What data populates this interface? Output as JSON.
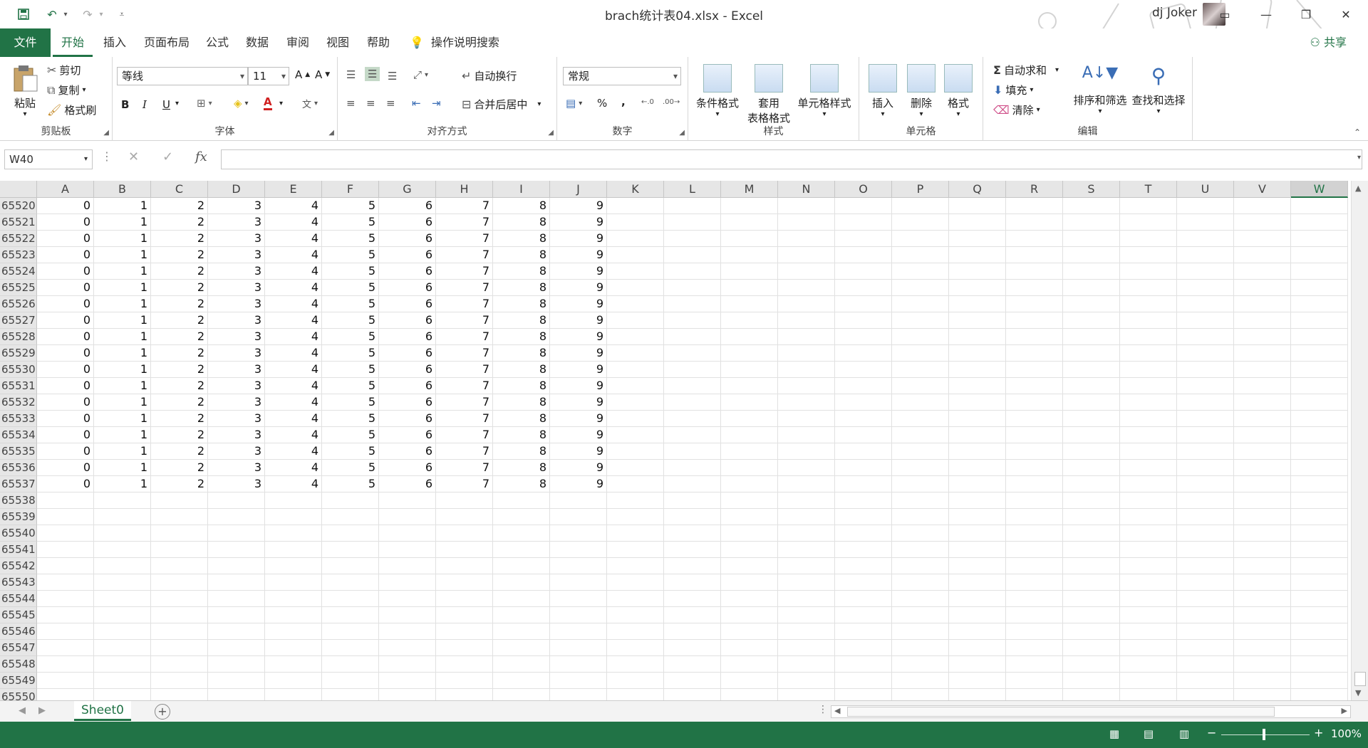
{
  "window": {
    "title": "brach统计表04.xlsx  -  Excel",
    "user": "dj Joker",
    "qat": {
      "save": "save-icon",
      "undo": "undo-icon",
      "redo": "redo-icon",
      "customize": "customize-icon"
    },
    "controls": {
      "ribbon_display": "▭",
      "minimize": "—",
      "restore": "❐",
      "close": "✕"
    }
  },
  "tabs": [
    "文件",
    "开始",
    "插入",
    "页面布局",
    "公式",
    "数据",
    "审阅",
    "视图",
    "帮助"
  ],
  "active_tab": "开始",
  "tell_me": "操作说明搜索",
  "share": "共享",
  "ribbon": {
    "clipboard": {
      "label": "剪贴板",
      "paste": "粘贴",
      "cut": "剪切",
      "copy": "复制",
      "format_painter": "格式刷"
    },
    "font": {
      "label": "字体",
      "font_name": "等线",
      "font_size": "11",
      "bold": "B",
      "italic": "I",
      "underline": "U",
      "grow": "A",
      "shrink": "A"
    },
    "alignment": {
      "label": "对齐方式",
      "wrap_text": "自动换行",
      "merge_center": "合并后居中"
    },
    "number": {
      "label": "数字",
      "format": "常规",
      "percent": "%",
      "comma": ","
    },
    "styles": {
      "label": "样式",
      "conditional": "条件格式",
      "table_l1": "套用",
      "table_l2": "表格格式",
      "cell_styles": "单元格样式"
    },
    "cells": {
      "label": "单元格",
      "insert": "插入",
      "delete": "删除",
      "format": "格式"
    },
    "editing": {
      "label": "编辑",
      "autosum": "自动求和",
      "fill": "填充",
      "clear": "清除",
      "sort_filter": "排序和筛选",
      "find_select": "查找和选择"
    }
  },
  "formula_bar": {
    "name_box": "W40",
    "fx": "fx",
    "value": ""
  },
  "grid": {
    "columns": [
      "A",
      "B",
      "C",
      "D",
      "E",
      "F",
      "G",
      "H",
      "I",
      "J",
      "K",
      "L",
      "M",
      "N",
      "O",
      "P",
      "Q",
      "R",
      "S",
      "T",
      "U",
      "V",
      "W"
    ],
    "selected_column": "W",
    "rows": [
      {
        "n": "65520",
        "v": [
          "0",
          "1",
          "2",
          "3",
          "4",
          "5",
          "6",
          "7",
          "8",
          "9"
        ]
      },
      {
        "n": "65521",
        "v": [
          "0",
          "1",
          "2",
          "3",
          "4",
          "5",
          "6",
          "7",
          "8",
          "9"
        ]
      },
      {
        "n": "65522",
        "v": [
          "0",
          "1",
          "2",
          "3",
          "4",
          "5",
          "6",
          "7",
          "8",
          "9"
        ]
      },
      {
        "n": "65523",
        "v": [
          "0",
          "1",
          "2",
          "3",
          "4",
          "5",
          "6",
          "7",
          "8",
          "9"
        ]
      },
      {
        "n": "65524",
        "v": [
          "0",
          "1",
          "2",
          "3",
          "4",
          "5",
          "6",
          "7",
          "8",
          "9"
        ]
      },
      {
        "n": "65525",
        "v": [
          "0",
          "1",
          "2",
          "3",
          "4",
          "5",
          "6",
          "7",
          "8",
          "9"
        ]
      },
      {
        "n": "65526",
        "v": [
          "0",
          "1",
          "2",
          "3",
          "4",
          "5",
          "6",
          "7",
          "8",
          "9"
        ]
      },
      {
        "n": "65527",
        "v": [
          "0",
          "1",
          "2",
          "3",
          "4",
          "5",
          "6",
          "7",
          "8",
          "9"
        ]
      },
      {
        "n": "65528",
        "v": [
          "0",
          "1",
          "2",
          "3",
          "4",
          "5",
          "6",
          "7",
          "8",
          "9"
        ]
      },
      {
        "n": "65529",
        "v": [
          "0",
          "1",
          "2",
          "3",
          "4",
          "5",
          "6",
          "7",
          "8",
          "9"
        ]
      },
      {
        "n": "65530",
        "v": [
          "0",
          "1",
          "2",
          "3",
          "4",
          "5",
          "6",
          "7",
          "8",
          "9"
        ]
      },
      {
        "n": "65531",
        "v": [
          "0",
          "1",
          "2",
          "3",
          "4",
          "5",
          "6",
          "7",
          "8",
          "9"
        ]
      },
      {
        "n": "65532",
        "v": [
          "0",
          "1",
          "2",
          "3",
          "4",
          "5",
          "6",
          "7",
          "8",
          "9"
        ]
      },
      {
        "n": "65533",
        "v": [
          "0",
          "1",
          "2",
          "3",
          "4",
          "5",
          "6",
          "7",
          "8",
          "9"
        ]
      },
      {
        "n": "65534",
        "v": [
          "0",
          "1",
          "2",
          "3",
          "4",
          "5",
          "6",
          "7",
          "8",
          "9"
        ]
      },
      {
        "n": "65535",
        "v": [
          "0",
          "1",
          "2",
          "3",
          "4",
          "5",
          "6",
          "7",
          "8",
          "9"
        ]
      },
      {
        "n": "65536",
        "v": [
          "0",
          "1",
          "2",
          "3",
          "4",
          "5",
          "6",
          "7",
          "8",
          "9"
        ]
      },
      {
        "n": "65537",
        "v": [
          "0",
          "1",
          "2",
          "3",
          "4",
          "5",
          "6",
          "7",
          "8",
          "9"
        ]
      },
      {
        "n": "65538",
        "v": []
      },
      {
        "n": "65539",
        "v": []
      },
      {
        "n": "65540",
        "v": []
      },
      {
        "n": "65541",
        "v": []
      },
      {
        "n": "65542",
        "v": []
      },
      {
        "n": "65543",
        "v": []
      },
      {
        "n": "65544",
        "v": []
      },
      {
        "n": "65545",
        "v": []
      },
      {
        "n": "65546",
        "v": []
      },
      {
        "n": "65547",
        "v": []
      },
      {
        "n": "65548",
        "v": []
      },
      {
        "n": "65549",
        "v": []
      },
      {
        "n": "65550",
        "v": []
      }
    ]
  },
  "sheets": [
    "Sheet0"
  ],
  "status": {
    "zoom": "100%",
    "zoom_minus": "−",
    "zoom_plus": "+"
  },
  "colors": {
    "accent": "#217346"
  }
}
